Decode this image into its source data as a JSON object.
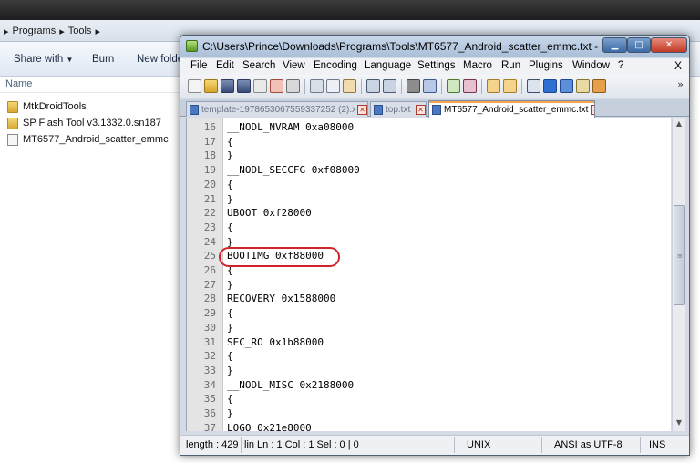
{
  "explorer": {
    "breadcrumb": [
      "Programs",
      "Tools"
    ],
    "toolbar": {
      "share": "Share with",
      "share_arrow": "▼",
      "burn": "Burn",
      "new_folder": "New folde"
    },
    "column_header": "Name",
    "files": [
      {
        "name": "MtkDroidTools",
        "icon": "folder-icon"
      },
      {
        "name": "SP Flash Tool v3.1332.0.sn187",
        "icon": "folder-icon"
      },
      {
        "name": "MT6577_Android_scatter_emmc",
        "icon": "text-file-icon"
      }
    ]
  },
  "notepad": {
    "title": "C:\\Users\\Prince\\Downloads\\Programs\\Tools\\MT6577_Android_scatter_emmc.txt - Notepad++",
    "menu": [
      "File",
      "Edit",
      "Search",
      "View",
      "Encoding",
      "Language",
      "Settings",
      "Macro",
      "Run",
      "Plugins",
      "Window",
      "?"
    ],
    "menu_close": "X",
    "toolbar_more": "»",
    "tabs": [
      {
        "label": "template-1978653067559337252 (2).xml",
        "active": false
      },
      {
        "label": "top.txt",
        "active": false
      },
      {
        "label": "MT6577_Android_scatter_emmc.txt",
        "active": true
      }
    ],
    "lines": [
      {
        "n": "16",
        "text": "__NODL_NVRAM 0xa08000"
      },
      {
        "n": "17",
        "text": "{"
      },
      {
        "n": "18",
        "text": "}"
      },
      {
        "n": "19",
        "text": "__NODL_SECCFG 0xf08000"
      },
      {
        "n": "20",
        "text": "{"
      },
      {
        "n": "21",
        "text": "}"
      },
      {
        "n": "22",
        "text": "UBOOT 0xf28000"
      },
      {
        "n": "23",
        "text": "{"
      },
      {
        "n": "24",
        "text": "}"
      },
      {
        "n": "25",
        "text": "BOOTIMG 0xf88000"
      },
      {
        "n": "26",
        "text": "{"
      },
      {
        "n": "27",
        "text": "}"
      },
      {
        "n": "28",
        "text": "RECOVERY 0x1588000"
      },
      {
        "n": "29",
        "text": "{"
      },
      {
        "n": "30",
        "text": "}"
      },
      {
        "n": "31",
        "text": "SEC_RO 0x1b88000"
      },
      {
        "n": "32",
        "text": "{"
      },
      {
        "n": "33",
        "text": "}"
      },
      {
        "n": "34",
        "text": "__NODL_MISC 0x2188000"
      },
      {
        "n": "35",
        "text": "{"
      },
      {
        "n": "36",
        "text": "}"
      },
      {
        "n": "37",
        "text": "LOGO 0x21e8000"
      }
    ],
    "status": {
      "length": "length : 429",
      "position": "lin Ln : 1    Col : 1    Sel : 0 | 0",
      "eol": "UNIX",
      "encoding": "ANSI as UTF-8",
      "mode": "INS"
    },
    "colors": {
      "highlight_ring": "#d0242a",
      "active_tab_accent": "#f3a64a"
    }
  }
}
